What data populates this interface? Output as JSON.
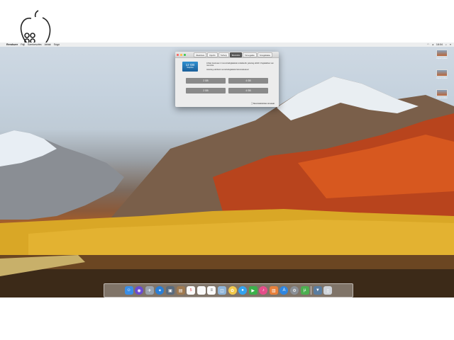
{
  "menubar": {
    "items": [
      "Rendszer",
      "Fájl",
      "Szerkesztés",
      "Ablak",
      "Súgó"
    ],
    "time": "18:04"
  },
  "desktop_icons": [
    {
      "label": "Képernyőfotó"
    },
    {
      "label": "Képernyőfotó"
    },
    {
      "label": "Képernyőfotó"
    }
  ],
  "window": {
    "tabs": [
      "Áttekintés",
      "Kijelző",
      "Tárhely",
      "Memória",
      "Támogatás",
      "Szolgáltatás"
    ],
    "active_tab": 3,
    "memory_size": "12 GB",
    "memory_sub": "Telepítve",
    "desc1": "A Mac összesen 4 memóriafoglalattal rendelkezik; jelenleg ebből 4 foglalatban van memória.",
    "desc2": "Jelenleg elérhető memóriafoglalatok felszerelésével",
    "slots": [
      "2 GB",
      "4 GB",
      "2 GB",
      "4 GB"
    ],
    "support_link": "Memóriabővítési útmutató"
  },
  "dock": {
    "icons": [
      "finder-icon",
      "siri-icon",
      "launchpad-icon",
      "safari-icon",
      "photo-icon",
      "notes-icon",
      "calendar-icon",
      "reminders-icon",
      "list-icon",
      "preview-icon",
      "photos-icon",
      "messages-icon",
      "facetime-icon",
      "itunes-icon",
      "books-icon",
      "appstore-icon",
      "settings-icon",
      "utorrent-icon",
      "folder-icon",
      "trash-icon"
    ]
  }
}
